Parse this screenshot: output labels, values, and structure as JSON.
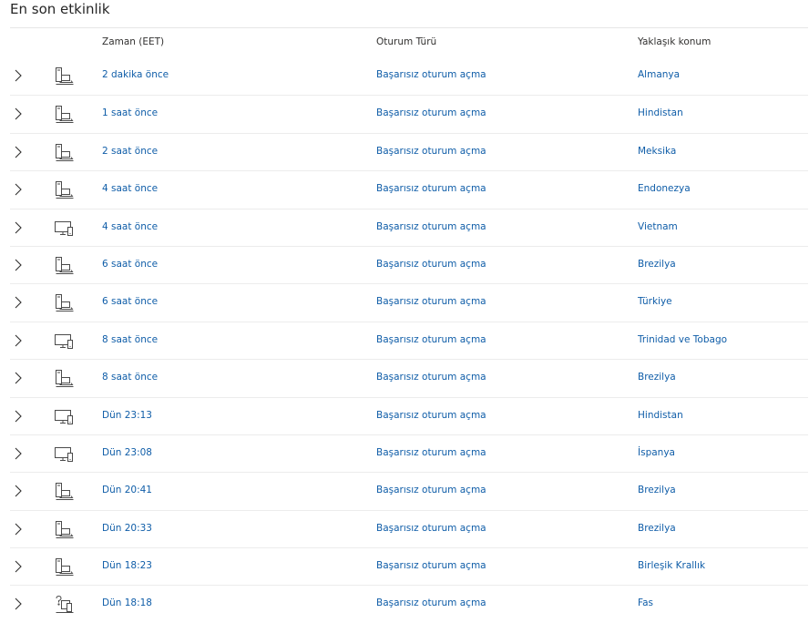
{
  "page": {
    "title": "En son etkinlik"
  },
  "table": {
    "headers": {
      "time": "Zaman (EET)",
      "type": "Oturum Türü",
      "location": "Yaklaşık konum"
    },
    "rows": [
      {
        "device_icon": "desktop-laptop-icon",
        "time": "2 dakika önce",
        "type": "Başarısız oturum açma",
        "location": "Almanya"
      },
      {
        "device_icon": "desktop-laptop-icon",
        "time": "1 saat önce",
        "type": "Başarısız oturum açma",
        "location": "Hindistan"
      },
      {
        "device_icon": "desktop-laptop-icon",
        "time": "2 saat önce",
        "type": "Başarısız oturum açma",
        "location": "Meksika"
      },
      {
        "device_icon": "desktop-laptop-icon",
        "time": "4 saat önce",
        "type": "Başarısız oturum açma",
        "location": "Endonezya"
      },
      {
        "device_icon": "monitor-phone-icon",
        "time": "4 saat önce",
        "type": "Başarısız oturum açma",
        "location": "Vietnam"
      },
      {
        "device_icon": "desktop-laptop-icon",
        "time": "6 saat önce",
        "type": "Başarısız oturum açma",
        "location": "Brezilya"
      },
      {
        "device_icon": "desktop-laptop-icon",
        "time": "6 saat önce",
        "type": "Başarısız oturum açma",
        "location": "Türkiye"
      },
      {
        "device_icon": "monitor-phone-icon",
        "time": "8 saat önce",
        "type": "Başarısız oturum açma",
        "location": "Trinidad ve Tobago"
      },
      {
        "device_icon": "desktop-laptop-icon",
        "time": "8 saat önce",
        "type": "Başarısız oturum açma",
        "location": "Brezilya"
      },
      {
        "device_icon": "monitor-phone-icon",
        "time": "Dün 23:13",
        "type": "Başarısız oturum açma",
        "location": "Hindistan"
      },
      {
        "device_icon": "monitor-phone-icon",
        "time": "Dün 23:08",
        "type": "Başarısız oturum açma",
        "location": "İspanya"
      },
      {
        "device_icon": "desktop-laptop-icon",
        "time": "Dün 20:41",
        "type": "Başarısız oturum açma",
        "location": "Brezilya"
      },
      {
        "device_icon": "desktop-laptop-icon",
        "time": "Dün 20:33",
        "type": "Başarısız oturum açma",
        "location": "Brezilya"
      },
      {
        "device_icon": "desktop-laptop-icon",
        "time": "Dün 18:23",
        "type": "Başarısız oturum açma",
        "location": "Birleşik Krallık"
      },
      {
        "device_icon": "unknown-device-icon",
        "time": "Dün 18:18",
        "type": "Başarısız oturum açma",
        "location": "Fas"
      }
    ]
  },
  "colors": {
    "link": "#0f5da8",
    "text": "#262626",
    "divider": "#ececec",
    "icon": "#4a4a4a"
  }
}
